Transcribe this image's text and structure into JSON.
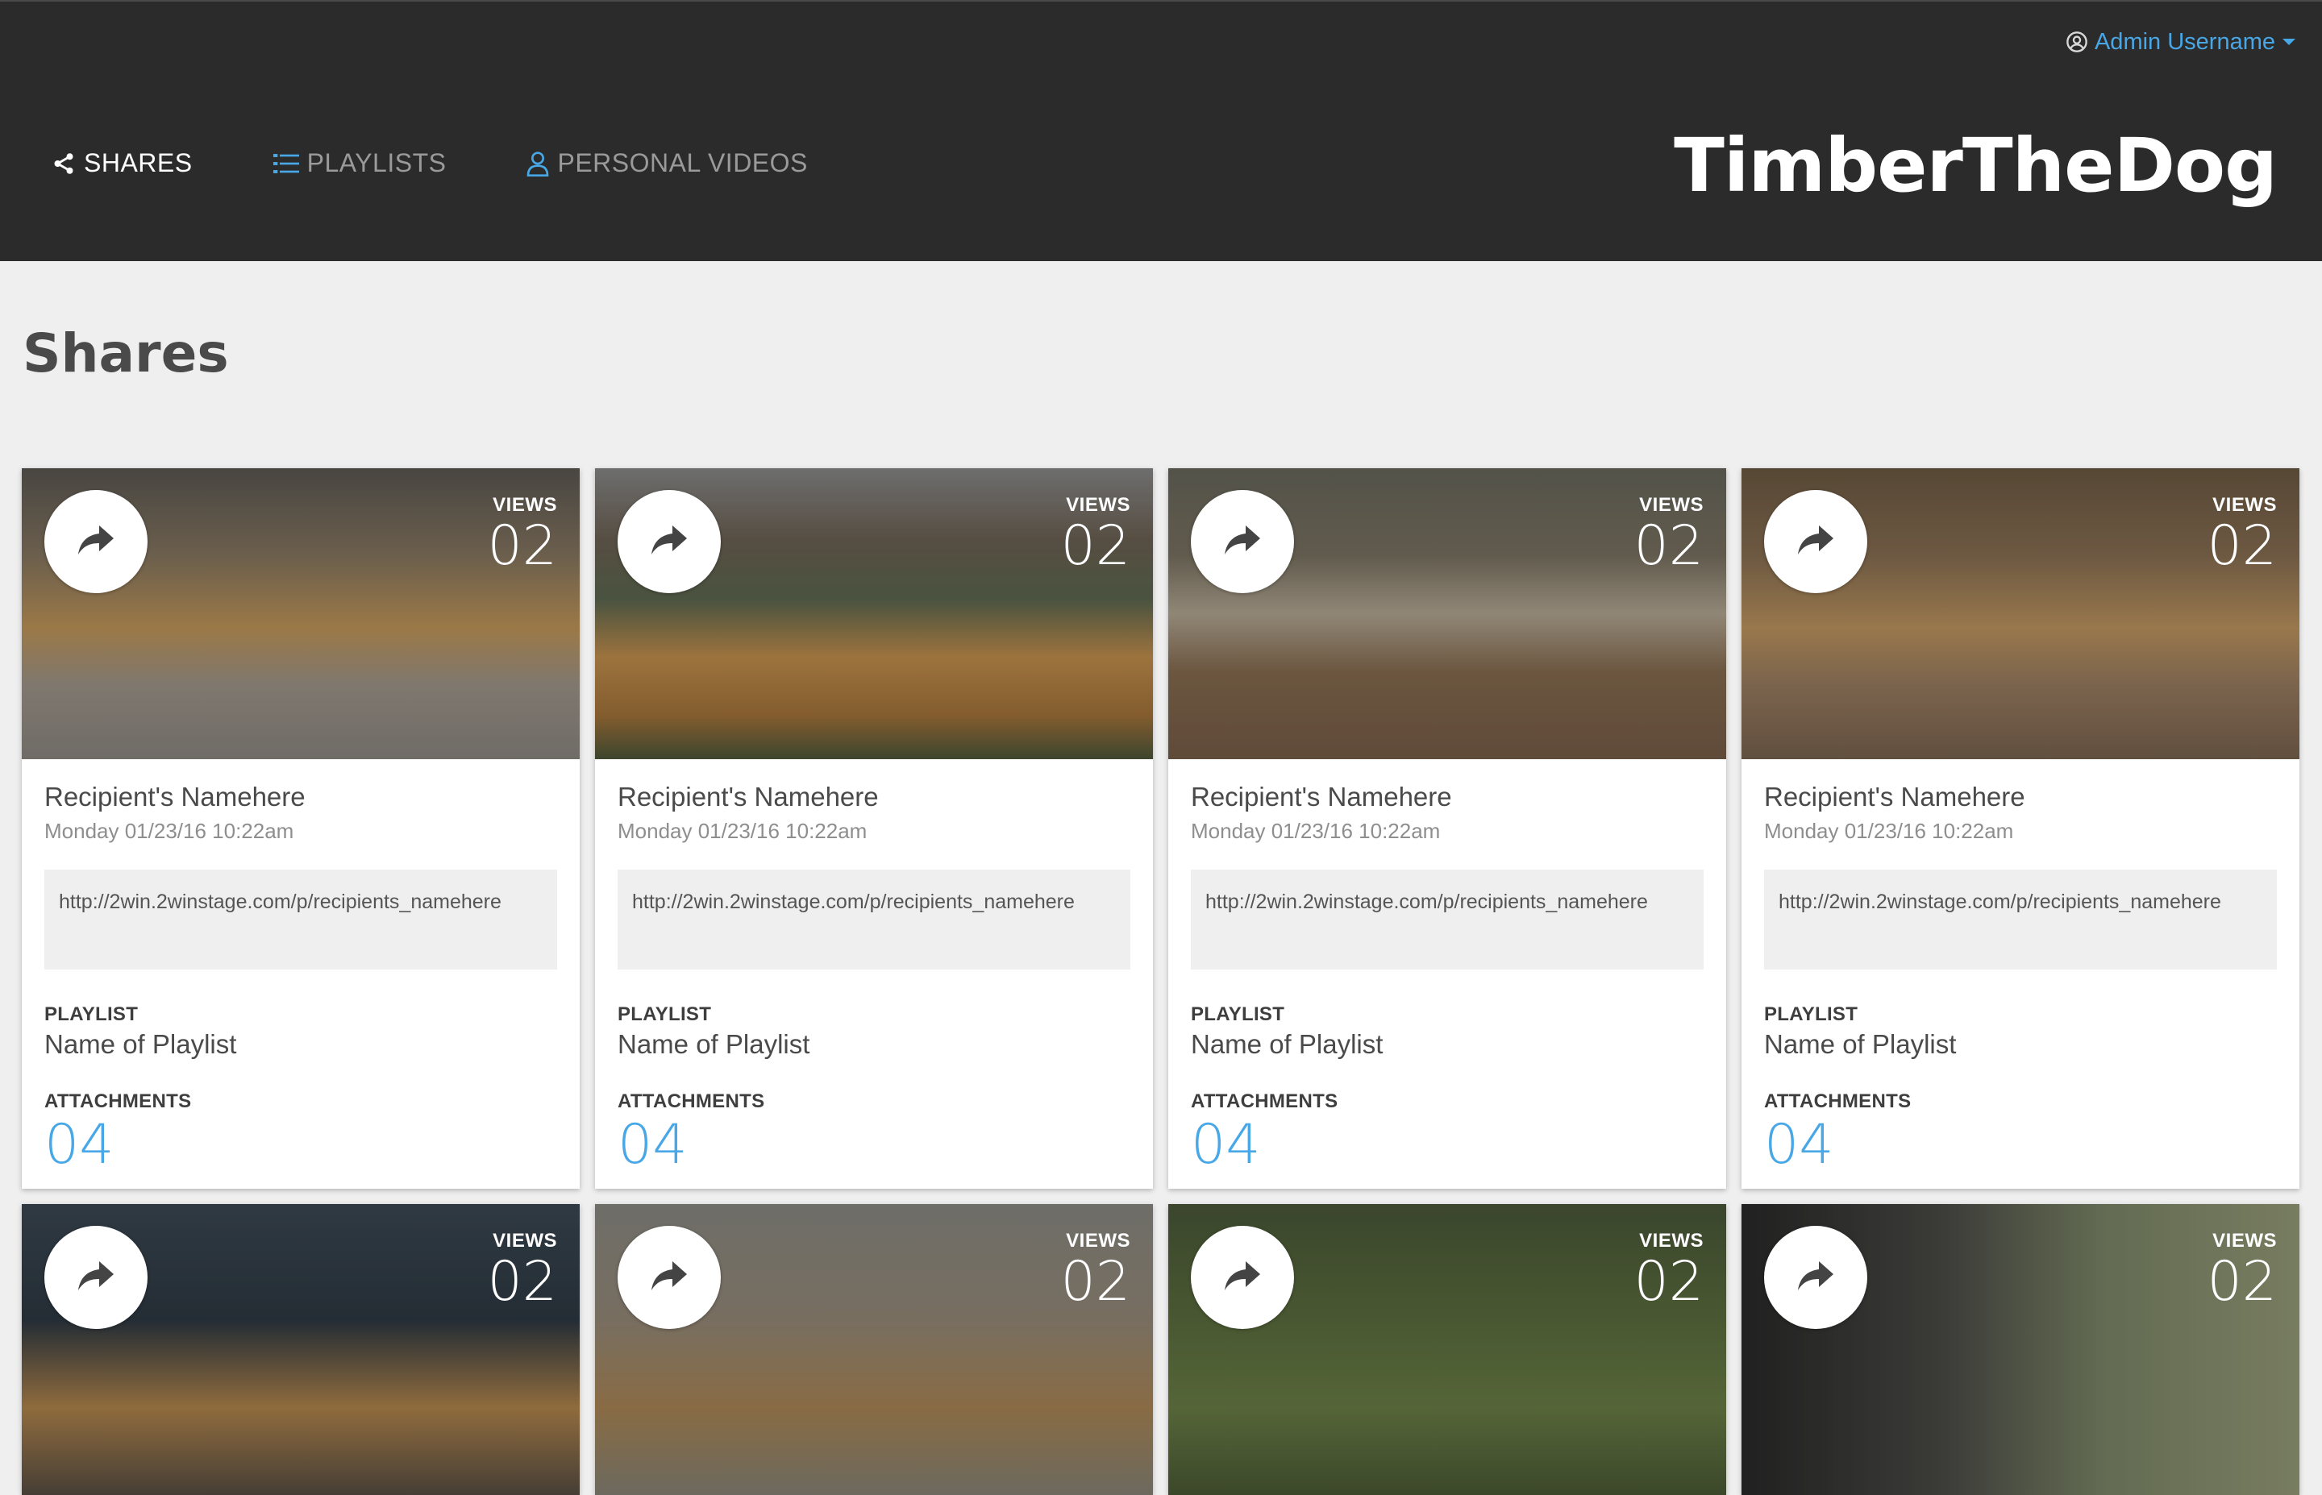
{
  "header": {
    "user_label": "Admin Username",
    "brand": "TimberTheDog",
    "nav": [
      {
        "label": "SHARES",
        "icon": "share-icon"
      },
      {
        "label": "PLAYLISTS",
        "icon": "list-icon"
      },
      {
        "label": "PERSONAL VIDEOS",
        "icon": "person-icon"
      }
    ]
  },
  "page": {
    "title": "Shares"
  },
  "cards": [
    {
      "views_label": "VIEWS",
      "views": "02",
      "recipient": "Recipient's Namehere",
      "date": "Monday 01/23/16 10:22am",
      "url": "http://2win.2winstage.com/p/recipients_namehere",
      "playlist_label": "PLAYLIST",
      "playlist": "Name of Playlist",
      "attachments_label": "ATTACHMENTS",
      "attachments": "04"
    },
    {
      "views_label": "VIEWS",
      "views": "02",
      "recipient": "Recipient's Namehere",
      "date": "Monday 01/23/16 10:22am",
      "url": "http://2win.2winstage.com/p/recipients_namehere",
      "playlist_label": "PLAYLIST",
      "playlist": "Name of Playlist",
      "attachments_label": "ATTACHMENTS",
      "attachments": "04"
    },
    {
      "views_label": "VIEWS",
      "views": "02",
      "recipient": "Recipient's Namehere",
      "date": "Monday 01/23/16 10:22am",
      "url": "http://2win.2winstage.com/p/recipients_namehere",
      "playlist_label": "PLAYLIST",
      "playlist": "Name of Playlist",
      "attachments_label": "ATTACHMENTS",
      "attachments": "04"
    },
    {
      "views_label": "VIEWS",
      "views": "02",
      "recipient": "Recipient's Namehere",
      "date": "Monday 01/23/16 10:22am",
      "url": "http://2win.2winstage.com/p/recipients_namehere",
      "playlist_label": "PLAYLIST",
      "playlist": "Name of Playlist",
      "attachments_label": "ATTACHMENTS",
      "attachments": "04"
    },
    {
      "views_label": "VIEWS",
      "views": "02"
    },
    {
      "views_label": "VIEWS",
      "views": "02"
    },
    {
      "views_label": "VIEWS",
      "views": "02"
    },
    {
      "views_label": "VIEWS",
      "views": "02"
    }
  ],
  "colors": {
    "accent": "#48a7e6",
    "topbar": "#2b2b2b",
    "background": "#efefef"
  }
}
